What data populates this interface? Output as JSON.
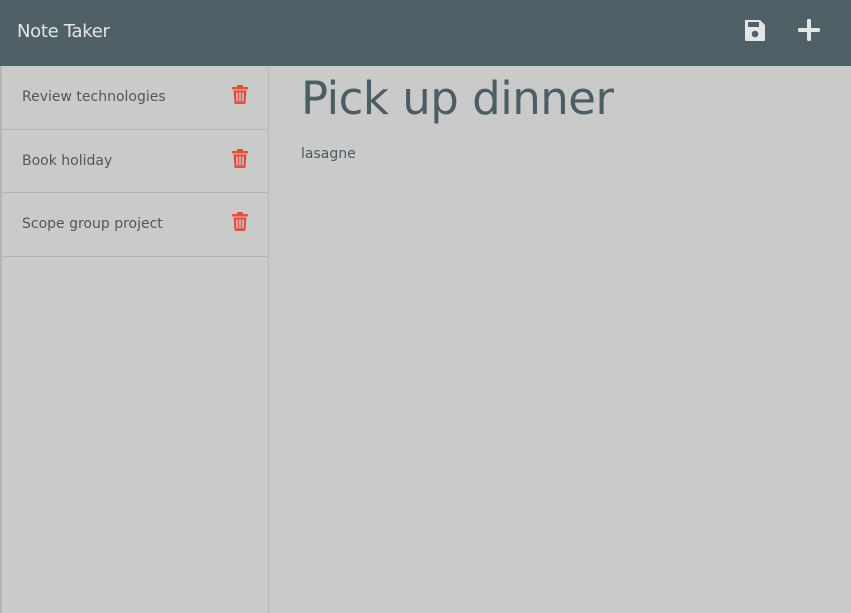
{
  "header": {
    "title": "Note Taker",
    "icons": [
      "save-icon",
      "plus-icon"
    ]
  },
  "sidebar": {
    "items": [
      {
        "label": "Review technologies",
        "icon": "trash-icon"
      },
      {
        "label": "Book holiday",
        "icon": "trash-icon"
      },
      {
        "label": "Scope group project",
        "icon": "trash-icon"
      }
    ]
  },
  "main": {
    "title": "Pick up dinner",
    "body": "lasagne"
  },
  "colors": {
    "navbar": "#4f6066",
    "background": "#cacaca",
    "trash": "#e74c3c",
    "text": "#4c5a5f"
  }
}
